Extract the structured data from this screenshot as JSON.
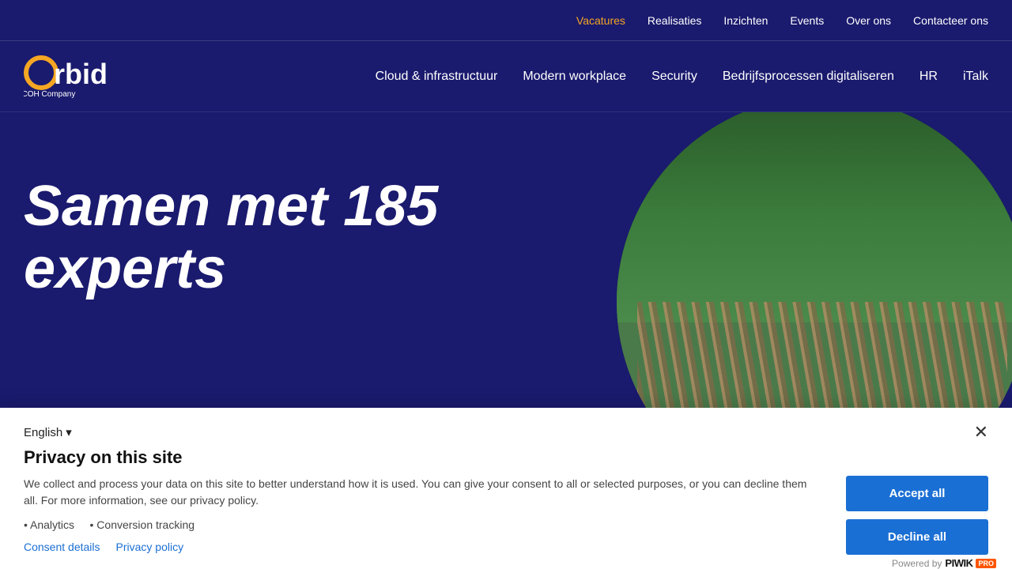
{
  "topbar": {
    "links": [
      {
        "id": "vacatures",
        "label": "Vacatures",
        "active": true
      },
      {
        "id": "realisaties",
        "label": "Realisaties",
        "active": false
      },
      {
        "id": "inzichten",
        "label": "Inzichten",
        "active": false
      },
      {
        "id": "events",
        "label": "Events",
        "active": false
      },
      {
        "id": "over-ons",
        "label": "Over ons",
        "active": false
      },
      {
        "id": "contacteer-ons",
        "label": "Contacteer ons",
        "active": false
      }
    ]
  },
  "nav": {
    "logo_alt": "Orbid - A RICOH Company",
    "links": [
      {
        "id": "cloud",
        "label": "Cloud & infrastructuur"
      },
      {
        "id": "modern-workplace",
        "label": "Modern workplace"
      },
      {
        "id": "security",
        "label": "Security"
      },
      {
        "id": "bedrijfsprocessen",
        "label": "Bedrijfsprocessen digitaliseren"
      },
      {
        "id": "hr",
        "label": "HR"
      },
      {
        "id": "italk",
        "label": "iTalk"
      }
    ]
  },
  "hero": {
    "headline_line1": "Samen met 185",
    "headline_line2": "experts"
  },
  "cookie_banner": {
    "language": "English",
    "language_chevron": "▾",
    "title": "Privacy on this site",
    "description": "We collect and process your data on this site to better understand how it is used. You can give your consent to all or selected purposes, or you can decline them all. For more information, see our privacy policy.",
    "bullet1": "• Analytics",
    "bullet2": "• Conversion tracking",
    "consent_details_label": "Consent details",
    "privacy_policy_label": "Privacy policy",
    "accept_all_label": "Accept all",
    "decline_all_label": "Decline all",
    "piwik_powered": "Powered by",
    "piwik_name": "PIWIK",
    "piwik_badge": "PRO"
  }
}
